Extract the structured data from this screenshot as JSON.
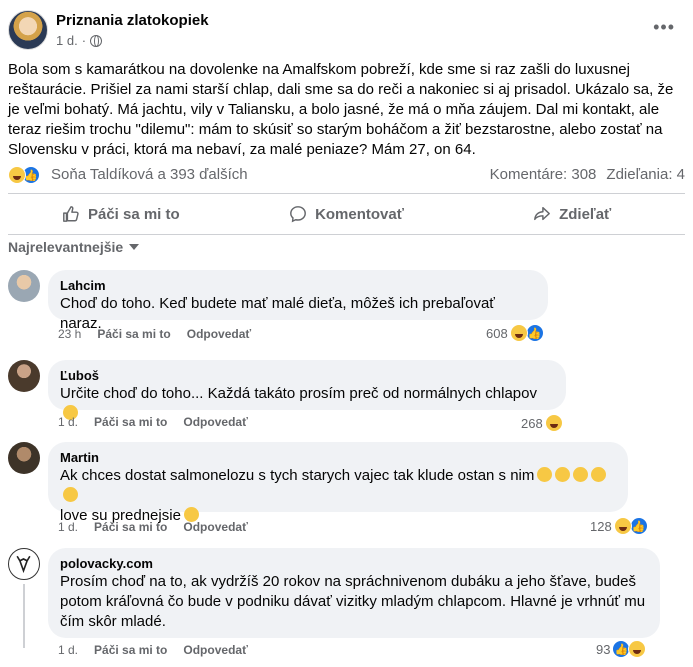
{
  "post": {
    "page_name": "Priznania zlatokopiek",
    "time": "1 d.",
    "text": "Bola som s kamarátkou na dovolenke na Amalfskom pobreží, kde sme si raz zašli do luxusnej reštaurácie. Prišiel za nami starší chlap, dali sme sa do reči a nakoniec si aj prisadol. Ukázalo sa, že je veľmi bohatý. Má jachtu, vily v Taliansku, a bolo jasné, že má o mňa záujem. Dal mi kontakt, ale teraz riešim trochu \"dilemu\": mám to skúsiť so starým boháčom a žiť bezstarostne, alebo zostať na Slovensku v práci, ktorá ma nebaví, za malé peniaze? Mám 27, on 64.",
    "reactions_text": "Soňa Taldíková a 393 ďalších",
    "comments_count": "Komentáre: 308",
    "shares_count": "Zdieľania: 4"
  },
  "actions": {
    "like": "Páči sa mi to",
    "comment": "Komentovať",
    "share": "Zdieľať"
  },
  "sort_label": "Najrelevantnejšie",
  "comments": [
    {
      "author": "Lahcim",
      "text": "Choď do toho. Keď budete mať malé dieťa, môžeš ich prebaľovať naraz.",
      "time": "23 h",
      "like": "Páči sa mi to",
      "reply": "Odpovedať",
      "count": "608"
    },
    {
      "author": "Ľuboš",
      "text": "Určite choď do toho... Každá takáto prosím preč od normálnych chlapov",
      "time": "1 d.",
      "like": "Páči sa mi to",
      "reply": "Odpovedať",
      "count": "268"
    },
    {
      "author": "Martin",
      "text_line1": "Ak chces dostat salmonelozu s tych starych vajec tak klude ostan s nim",
      "text_line2": "love su prednejsie",
      "time": "1 d.",
      "like": "Páči sa mi to",
      "reply": "Odpovedať",
      "count": "128"
    },
    {
      "author": "polovacky.com",
      "text": "Prosím choď na to, ak vydržíš 20 rokov na spráchnivenom dubáku a jeho šťave, budeš potom kráľovná čo bude v podniku dávať vizitky mladým chlapcom. Hlavné je vrhnúť mu čím skôr mladé.",
      "time": "1 d.",
      "like": "Páči sa mi to",
      "reply": "Odpovedať",
      "count": "93"
    }
  ]
}
